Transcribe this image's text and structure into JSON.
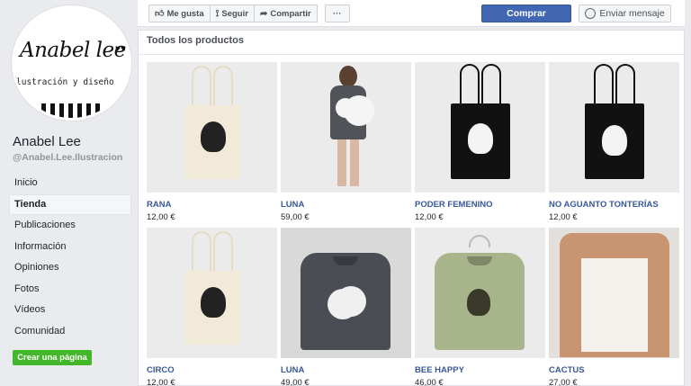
{
  "page": {
    "logo_script": "Anabel lee",
    "logo_sub": "lustración y diseño",
    "name": "Anabel Lee",
    "handle": "@Anabel.Lee.Ilustracion"
  },
  "nav": [
    {
      "label": "Inicio",
      "active": false
    },
    {
      "label": "Tienda",
      "active": true
    },
    {
      "label": "Publicaciones",
      "active": false
    },
    {
      "label": "Información",
      "active": false
    },
    {
      "label": "Opiniones",
      "active": false
    },
    {
      "label": "Fotos",
      "active": false
    },
    {
      "label": "Vídeos",
      "active": false
    },
    {
      "label": "Comunidad",
      "active": false
    }
  ],
  "create_page_label": "Crear una página",
  "actions": {
    "like": "Me gusta",
    "follow": "Seguir",
    "share": "Compartir",
    "more": "···",
    "buy": "Comprar",
    "message": "Enviar mensaje"
  },
  "shop": {
    "title": "Todos los productos",
    "products": [
      {
        "name": "RANA",
        "price": "12,00 €",
        "kind": "tote-light"
      },
      {
        "name": "LUNA",
        "price": "59,00 €",
        "kind": "model"
      },
      {
        "name": "PODER FEMENINO",
        "price": "12,00 €",
        "kind": "tote-dark"
      },
      {
        "name": "NO AGUANTO TONTERÍAS",
        "price": "12,00 €",
        "kind": "tote-dark"
      },
      {
        "name": "CIRCO",
        "price": "12,00 €",
        "kind": "tote-light"
      },
      {
        "name": "LUNA",
        "price": "49,00 €",
        "kind": "sweater-grey"
      },
      {
        "name": "BEE HAPPY",
        "price": "46,00 €",
        "kind": "sweater-green"
      },
      {
        "name": "CACTUS",
        "price": "27,00 €",
        "kind": "tshirt"
      }
    ]
  },
  "colors": {
    "link": "#385898",
    "primary": "#4267b2",
    "create": "#42b72a",
    "background": "#e9ebee"
  }
}
